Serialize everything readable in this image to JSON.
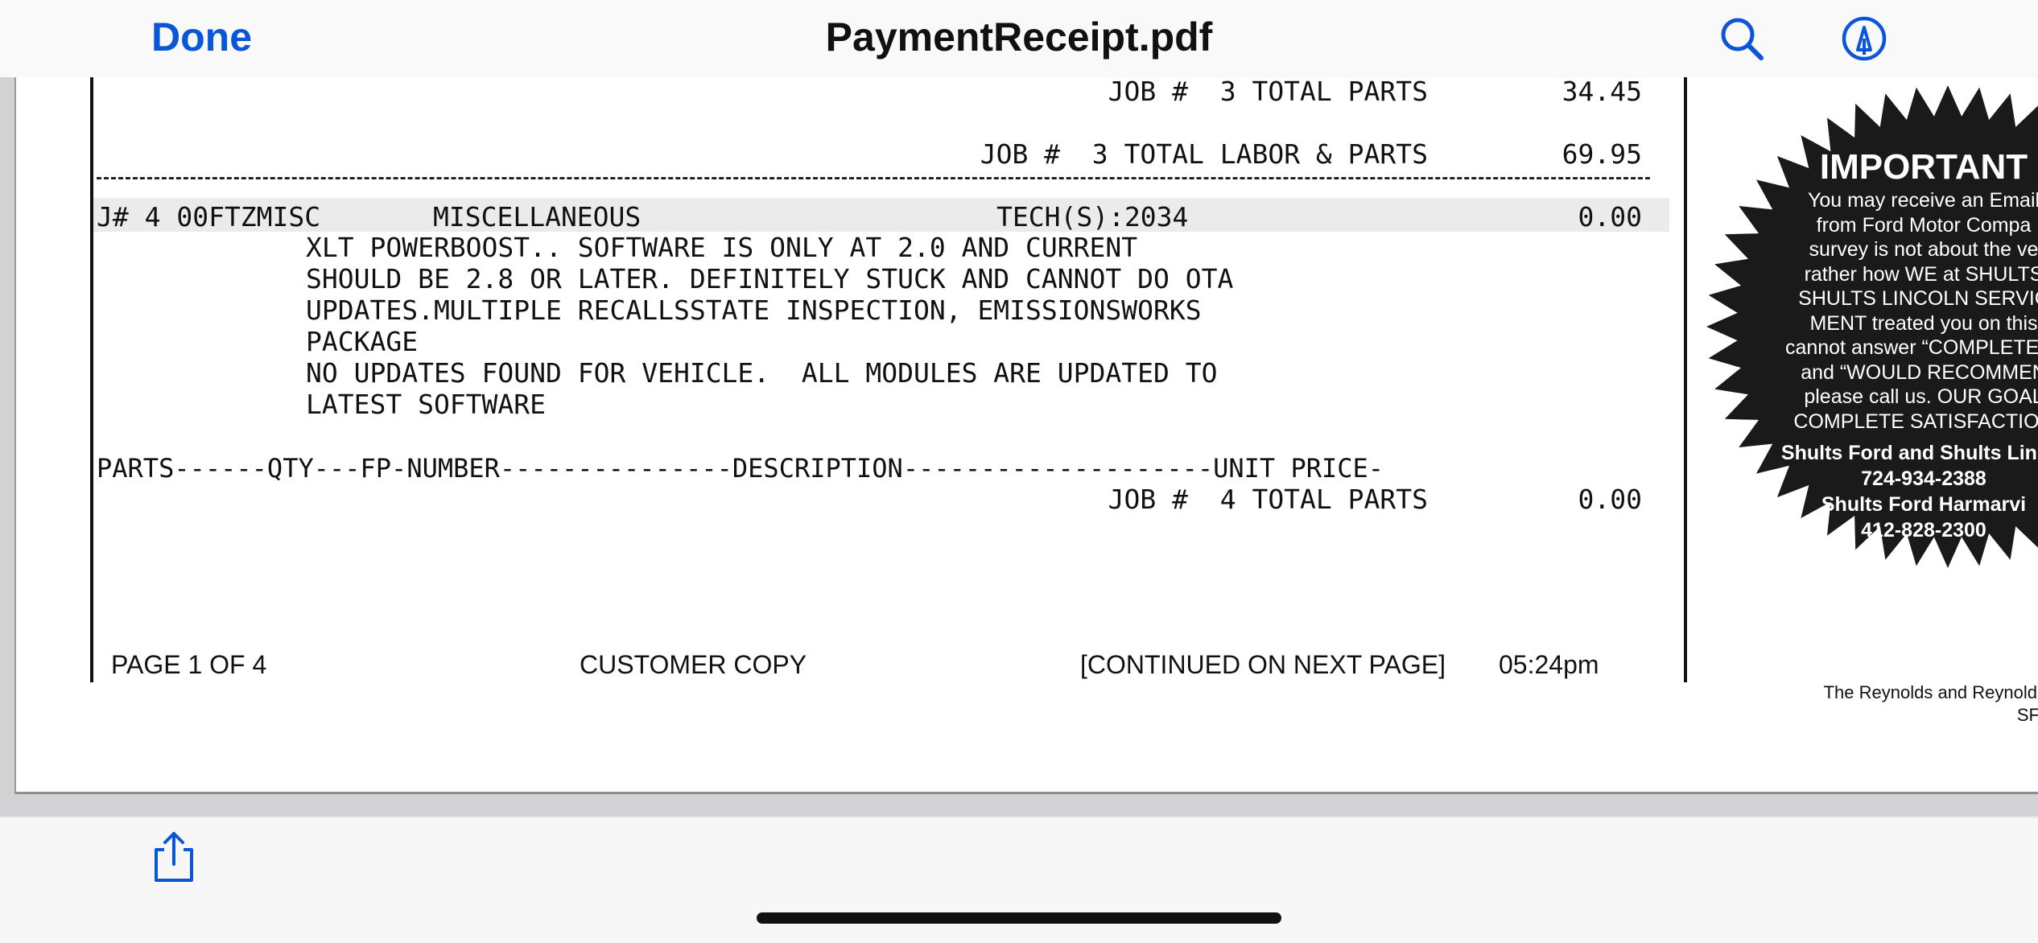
{
  "nav": {
    "done_label": "Done",
    "title": "PaymentReceipt.pdf",
    "search_icon": "magnifier",
    "markup_icon": "pen-circle"
  },
  "document": {
    "job3_parts": {
      "label": "JOB #  3 TOTAL PARTS",
      "amount": "34.45"
    },
    "job3_labor_parts": {
      "label": "JOB #  3 TOTAL LABOR & PARTS",
      "amount": "69.95"
    },
    "job4_header": {
      "code": "J# 4 00FTZMISC",
      "category": "MISCELLANEOUS",
      "tech": "TECH(S):2034",
      "amount": "0.00"
    },
    "job4_notes": [
      "XLT POWERBOOST.. SOFTWARE IS ONLY AT 2.0 AND CURRENT",
      "SHOULD BE 2.8 OR LATER. DEFINITELY STUCK AND CANNOT DO OTA",
      "UPDATES.MULTIPLE RECALLSSTATE INSPECTION, EMISSIONSWORKS",
      "PACKAGE",
      "NO UPDATES FOUND FOR VEHICLE.  ALL MODULES ARE UPDATED TO",
      "LATEST SOFTWARE"
    ],
    "parts_header": "PARTS------QTY---FP-NUMBER---------------DESCRIPTION--------------------UNIT PRICE-",
    "job4_parts": {
      "label": "JOB #  4 TOTAL PARTS",
      "amount": "0.00"
    },
    "footer": {
      "page": "PAGE 1 OF 4",
      "copy": "CUSTOMER COPY",
      "continued": "[CONTINUED ON NEXT PAGE]",
      "time": "05:24pm"
    },
    "badge": {
      "heading": "IMPORTANT",
      "lines": [
        "You may receive an Email",
        "from Ford Motor Compa",
        "survey is not about the ve",
        "rather how WE at SHULTS",
        "SHULTS LINCOLN SERVIC",
        "MENT treated you on this",
        "cannot answer “COMPLETELY",
        "and “WOULD RECOMMEN",
        "please call us. OUR GOAL",
        "COMPLETE SATISFACTION"
      ],
      "contacts": [
        "Shults Ford and Shults Lincol",
        "724-934-2388",
        "Shults Ford Harmarvi",
        "412-828-2300"
      ]
    },
    "publisher_lines": [
      "The Reynolds and Reynolds C",
      "SF"
    ]
  },
  "toolbar": {
    "share_icon": "share"
  }
}
